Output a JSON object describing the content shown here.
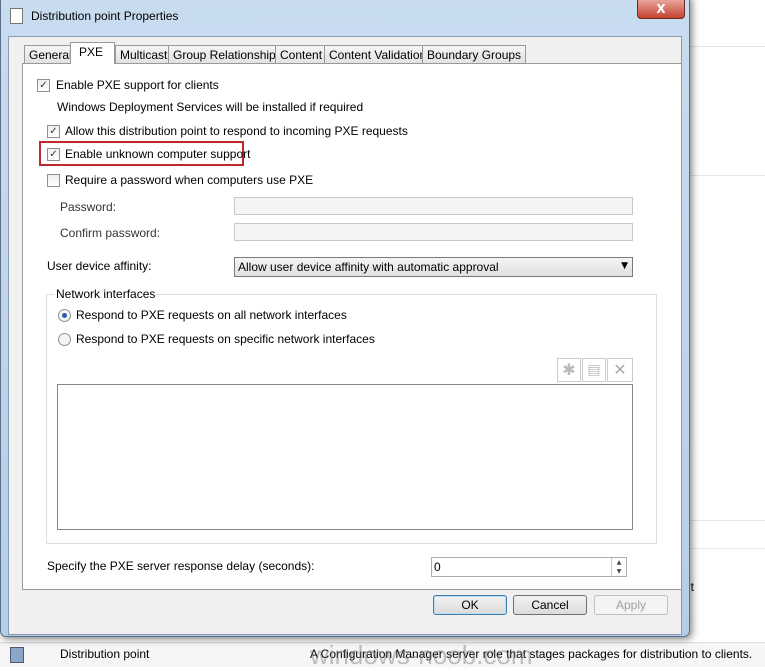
{
  "window": {
    "title": "Distribution point Properties",
    "close": "X"
  },
  "tabs": [
    "General",
    "PXE",
    "Multicast",
    "Group Relationships",
    "Content",
    "Content Validation",
    "Boundary Groups"
  ],
  "pxe": {
    "enable_pxe": "Enable PXE support for clients",
    "enable_pxe_checked": true,
    "wds_note": "Windows Deployment Services will be installed if required",
    "allow_respond": "Allow this distribution point to respond to incoming PXE requests",
    "allow_respond_checked": true,
    "unknown_support": "Enable unknown computer support",
    "unknown_support_checked": true,
    "require_password": "Require a password when computers use PXE",
    "require_password_checked": false,
    "password_label": "Password:",
    "password_value": "",
    "confirm_label": "Confirm password:",
    "confirm_value": "",
    "affinity_label": "User device affinity:",
    "affinity_value": "Allow user device affinity with automatic approval",
    "network_group": "Network interfaces",
    "radio_all": "Respond to PXE requests on all network interfaces",
    "radio_specific": "Respond to PXE requests on specific network interfaces",
    "selected_radio": "all",
    "delay_label": "Specify the PXE server response delay (seconds):",
    "delay_value": "0"
  },
  "buttons": {
    "ok": "OK",
    "cancel": "Cancel",
    "apply": "Apply"
  },
  "background": {
    "row_name": "Distribution point",
    "row_desc": "A Configuration Manager server role that stages packages for distribution to clients.",
    "partial_text": "nt",
    "watermark": "windows-noob.com"
  },
  "highlight_color": "#c0282d"
}
